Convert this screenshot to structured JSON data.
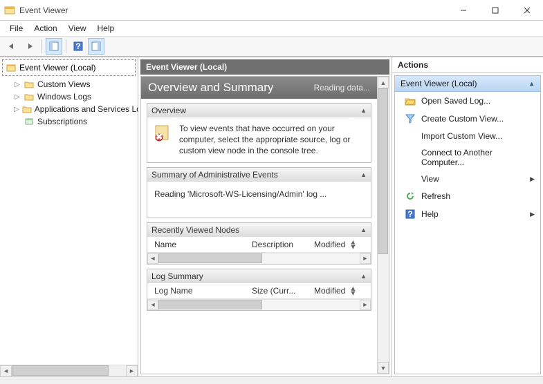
{
  "window": {
    "title": "Event Viewer"
  },
  "menu": {
    "file": "File",
    "action": "Action",
    "view": "View",
    "help": "Help"
  },
  "tree": {
    "root": "Event Viewer (Local)",
    "items": [
      "Custom Views",
      "Windows Logs",
      "Applications and Services Lo",
      "Subscriptions"
    ]
  },
  "mid": {
    "header": "Event Viewer (Local)",
    "overview_title": "Overview and Summary",
    "overview_status": "Reading data...",
    "sections": {
      "overview": {
        "title": "Overview",
        "text": "To view events that have occurred on your computer, select the appropriate source, log or custom view node in the console tree."
      },
      "summary": {
        "title": "Summary of Administrative Events",
        "text": "Reading 'Microsoft-WS-Licensing/Admin' log ..."
      },
      "recent": {
        "title": "Recently Viewed Nodes",
        "cols": [
          "Name",
          "Description",
          "Modified"
        ]
      },
      "logsum": {
        "title": "Log Summary",
        "cols": [
          "Log Name",
          "Size (Curr...",
          "Modified"
        ]
      }
    }
  },
  "actions": {
    "title": "Actions",
    "subtitle": "Event Viewer (Local)",
    "items": [
      {
        "label": "Open Saved Log...",
        "icon": "folder-open-icon"
      },
      {
        "label": "Create Custom View...",
        "icon": "funnel-icon"
      },
      {
        "label": "Import Custom View...",
        "icon": null,
        "indent": true
      },
      {
        "label": "Connect to Another Computer...",
        "icon": null,
        "indent": true
      },
      {
        "label": "View",
        "icon": null,
        "indent": true,
        "submenu": true
      },
      {
        "label": "Refresh",
        "icon": "refresh-icon"
      },
      {
        "label": "Help",
        "icon": "help-icon",
        "submenu": true
      }
    ]
  }
}
